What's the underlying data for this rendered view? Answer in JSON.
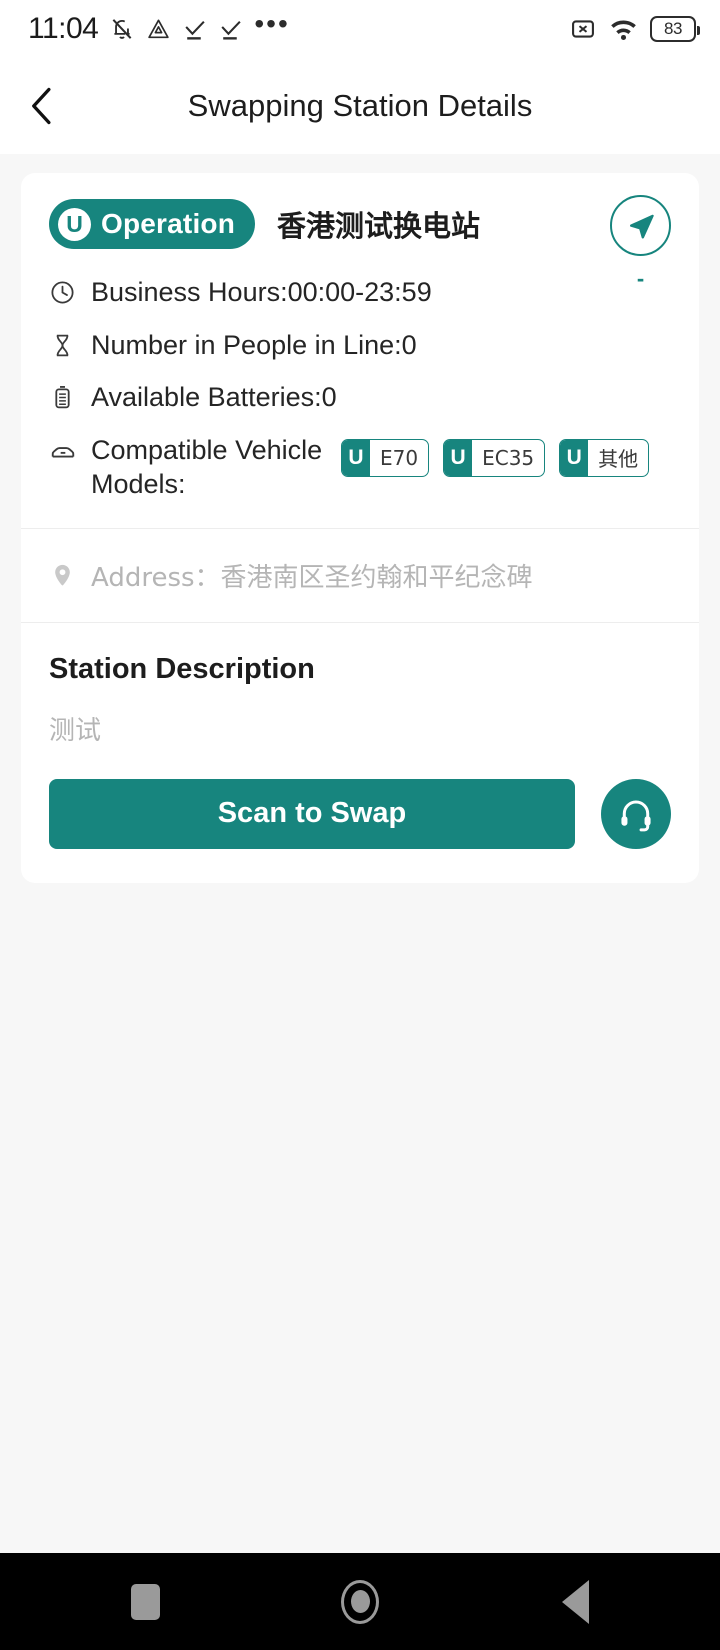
{
  "status_bar": {
    "time": "11:04",
    "left_icons": [
      "bell-muted-icon",
      "drive-triangle-icon",
      "check-download-icon",
      "check-download-icon",
      "more-dots-icon"
    ],
    "right_icons": [
      "sim-disabled-icon",
      "wifi-icon"
    ],
    "battery_level": "83"
  },
  "header": {
    "back_icon": "chevron-left-icon",
    "title": "Swapping Station Details"
  },
  "station": {
    "status_badge": {
      "logo_letter": "U",
      "label": "Operation"
    },
    "name": "香港测试换电站",
    "navigate_icon": "navigation-arrow-icon",
    "distance": "-",
    "info": [
      {
        "icon": "clock-icon",
        "text": "Business Hours:00:00-23:59"
      },
      {
        "icon": "hourglass-icon",
        "text": "Number in People in Line:0"
      },
      {
        "icon": "battery-icon",
        "text": "Available Batteries:0"
      }
    ],
    "models_label": "Compatible Vehicle Models:",
    "models_icon": "car-icon",
    "models": [
      {
        "logo_letter": "U",
        "name": "E70"
      },
      {
        "logo_letter": "U",
        "name": "EC35"
      },
      {
        "logo_letter": "U",
        "name": "其他"
      }
    ],
    "address_icon": "location-pin-icon",
    "address": "Address：香港南区圣约翰和平纪念碑"
  },
  "description": {
    "title": "Station Description",
    "body": "测试"
  },
  "actions": {
    "scan_label": "Scan to Swap",
    "support_icon": "headset-icon"
  },
  "navigation_bar": {
    "recent_icon": "square-recents-icon",
    "home_icon": "circle-home-icon",
    "back_icon": "triangle-back-icon"
  },
  "colors": {
    "accent": "#17857e",
    "page_bg": "#f7f7f7",
    "card_bg": "#ffffff",
    "muted_text": "#b5b5b5"
  }
}
